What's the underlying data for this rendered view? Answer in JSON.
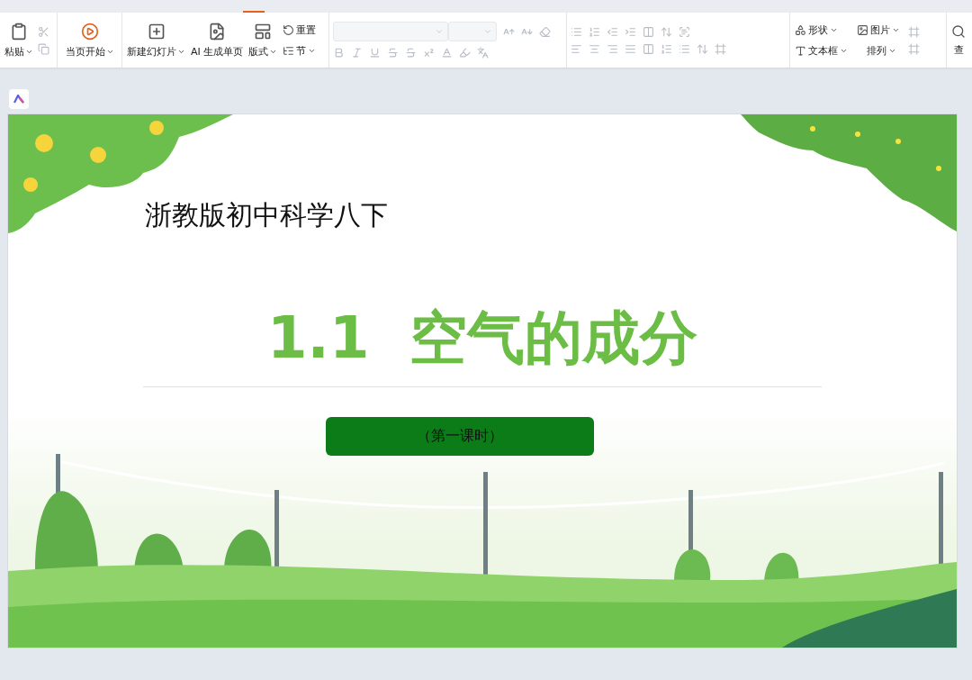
{
  "ribbon": {
    "paste": {
      "label": "粘贴",
      "caret": true
    },
    "clipboard_tools": {
      "disabled": true
    },
    "play": {
      "label": "当页开始",
      "caret": true
    },
    "slides": [
      {
        "label": "新建幻灯片",
        "caret": true
      },
      {
        "label": "AI 生成单页",
        "caret": false
      },
      {
        "label": "版式",
        "caret": true
      }
    ],
    "slide_small": [
      {
        "label": "重置",
        "caret": false
      },
      {
        "label": "节",
        "caret": true
      }
    ],
    "font_tools": {
      "disabled": true
    },
    "paragraph_tools": {
      "disabled": true
    },
    "insert": [
      {
        "label": "形状",
        "caret": true
      },
      {
        "label": "文本框",
        "caret": true
      },
      {
        "label": "图片",
        "caret": true
      },
      {
        "label": "排列",
        "caret": true
      }
    ],
    "find": {
      "label": "查"
    }
  },
  "slide": {
    "subtitle": "浙教版初中科学八下",
    "title": "1.1  空气的成分",
    "lesson_button": "（第一课时）"
  }
}
